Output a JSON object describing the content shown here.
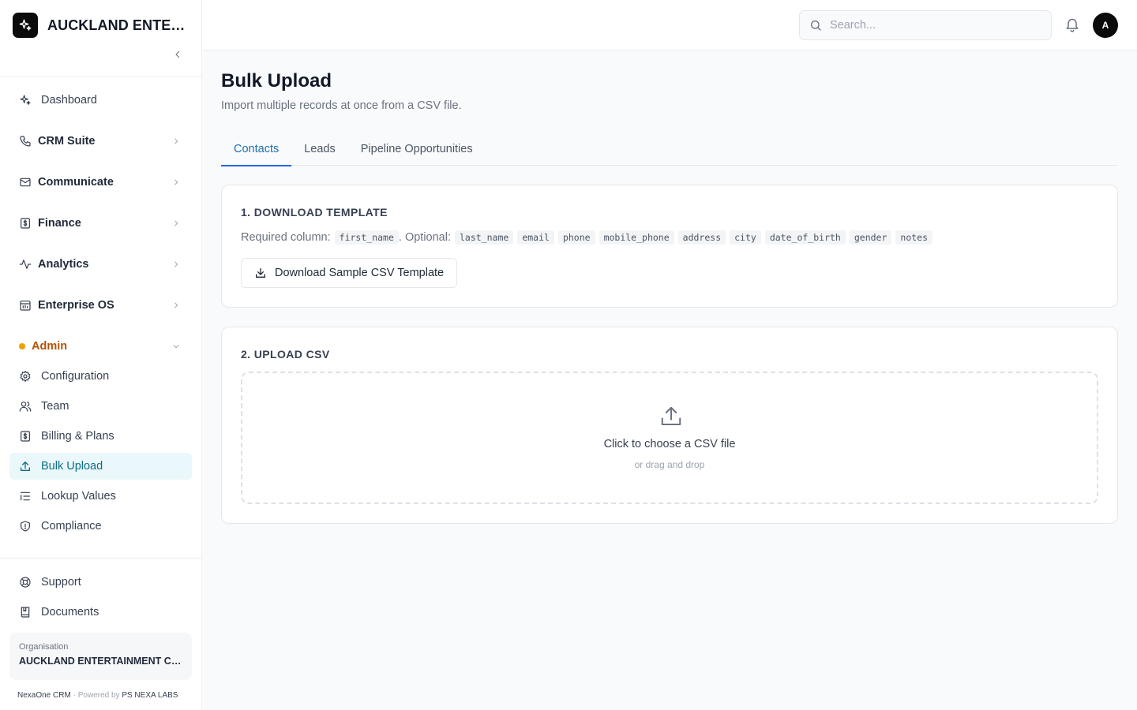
{
  "brand": {
    "name": "AUCKLAND ENTER..."
  },
  "sidebar": {
    "items": [
      {
        "label": "Dashboard",
        "icon": "sparkles-icon"
      },
      {
        "label": "CRM Suite",
        "icon": "phone-icon"
      },
      {
        "label": "Communicate",
        "icon": "mail-icon"
      },
      {
        "label": "Finance",
        "icon": "receipt-icon"
      },
      {
        "label": "Analytics",
        "icon": "activity-icon"
      },
      {
        "label": "Enterprise OS",
        "icon": "calendar-chart-icon"
      }
    ],
    "admin": {
      "label": "Admin",
      "items": [
        {
          "label": "Configuration",
          "icon": "gear-icon"
        },
        {
          "label": "Team",
          "icon": "users-icon"
        },
        {
          "label": "Billing & Plans",
          "icon": "receipt-icon"
        },
        {
          "label": "Bulk Upload",
          "icon": "upload-icon",
          "active": true
        },
        {
          "label": "Lookup Values",
          "icon": "list-icon"
        },
        {
          "label": "Compliance",
          "icon": "shield-icon"
        }
      ]
    },
    "bottom": [
      {
        "label": "Support",
        "icon": "lifebuoy-icon"
      },
      {
        "label": "Documents",
        "icon": "book-icon"
      }
    ],
    "organisation": {
      "label": "Organisation",
      "name": "AUCKLAND ENTERTAINMENT CO..."
    },
    "footer": {
      "product": "NexaOne CRM",
      "separator": "·",
      "powered_by": "Powered by",
      "company": "PS NEXA LABS"
    }
  },
  "topbar": {
    "search_placeholder": "Search...",
    "avatar_initial": "A"
  },
  "page": {
    "title": "Bulk Upload",
    "subtitle": "Import multiple records at once from a CSV file.",
    "tabs": [
      "Contacts",
      "Leads",
      "Pipeline Opportunities"
    ],
    "active_tab": "Contacts"
  },
  "template_card": {
    "title": "1. DOWNLOAD TEMPLATE",
    "required_label": "Required column:",
    "required_columns": [
      "first_name"
    ],
    "optional_label": ". Optional:",
    "optional_columns": [
      "last_name",
      "email",
      "phone",
      "mobile_phone",
      "address",
      "city",
      "date_of_birth",
      "gender",
      "notes"
    ],
    "download_label": "Download Sample CSV Template"
  },
  "upload_card": {
    "title": "2. UPLOAD CSV",
    "dropzone_title": "Click to choose a CSV file",
    "dropzone_sub": "or drag and drop"
  },
  "colors": {
    "accent": "#2563eb",
    "active_nav_bg": "#eaf7fb",
    "active_nav_text": "#0e6f82",
    "admin_text": "#b45309",
    "admin_dot": "#f59e0b"
  }
}
